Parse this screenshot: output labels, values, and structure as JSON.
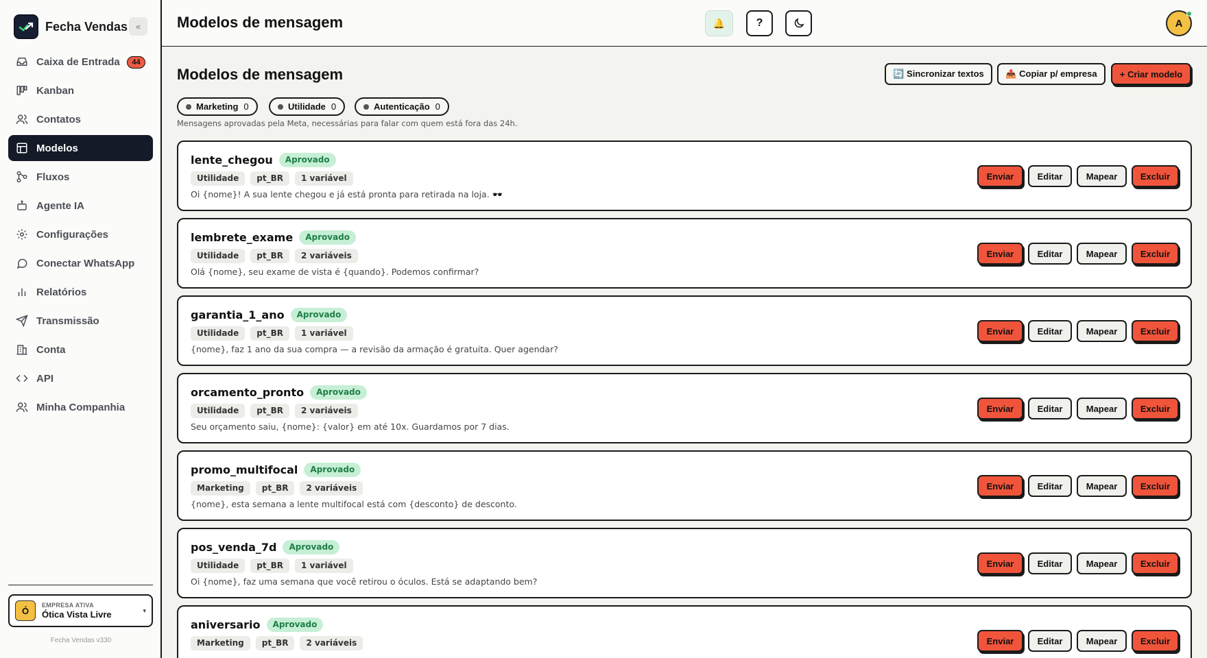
{
  "app": {
    "name": "Fecha Vendas",
    "collapse_icon": "«",
    "version": "Fecha Vendas v330"
  },
  "sidebar": {
    "items": [
      {
        "label": "Caixa de Entrada",
        "icon": "inbox-icon",
        "badge": "44"
      },
      {
        "label": "Kanban",
        "icon": "kanban-icon"
      },
      {
        "label": "Contatos",
        "icon": "contacts-icon"
      },
      {
        "label": "Modelos",
        "icon": "templates-icon",
        "active": true
      },
      {
        "label": "Fluxos",
        "icon": "flows-icon"
      },
      {
        "label": "Agente IA",
        "icon": "robot-icon"
      },
      {
        "label": "Configurações",
        "icon": "gear-icon"
      },
      {
        "label": "Conectar WhatsApp",
        "icon": "chat-bubble-icon"
      },
      {
        "label": "Relatórios",
        "icon": "bar-chart-icon"
      },
      {
        "label": "Transmissão",
        "icon": "send-icon"
      },
      {
        "label": "Conta",
        "icon": "building-icon"
      },
      {
        "label": "API",
        "icon": "code-icon"
      },
      {
        "label": "Minha Companhia",
        "icon": "users-icon"
      }
    ],
    "company": {
      "label": "EMPRESA ATIVA",
      "initial": "Ó",
      "name": "Ótica Vista Livre",
      "caret": "▾"
    }
  },
  "header": {
    "title": "Modelos de mensagem",
    "bell": "🔔",
    "help": "?",
    "user_initial": "A"
  },
  "main": {
    "title": "Modelos de mensagem",
    "actions": {
      "sync": "🔄 Sincronizar textos",
      "copy": "📤 Copiar p/ empresa",
      "create": "+ Criar modelo"
    },
    "filters": [
      {
        "label": "Marketing",
        "count": "0"
      },
      {
        "label": "Utilidade",
        "count": "0"
      },
      {
        "label": "Autenticação",
        "count": "0"
      }
    ],
    "subtitle": "Mensagens aprovadas pela Meta, necessárias para falar com quem está fora das 24h.",
    "button_labels": {
      "send": "Enviar",
      "edit": "Editar",
      "map": "Mapear",
      "delete": "Excluir"
    },
    "templates": [
      {
        "name": "lente_chegou",
        "status": "Aprovado",
        "category": "Utilidade",
        "language": "pt_BR",
        "variables": "1 variável",
        "body": "Oi {nome}! A sua lente chegou e já está pronta para retirada na loja. 🕶️"
      },
      {
        "name": "lembrete_exame",
        "status": "Aprovado",
        "category": "Utilidade",
        "language": "pt_BR",
        "variables": "2 variáveis",
        "body": "Olá {nome}, seu exame de vista é {quando}. Podemos confirmar?"
      },
      {
        "name": "garantia_1_ano",
        "status": "Aprovado",
        "category": "Utilidade",
        "language": "pt_BR",
        "variables": "1 variável",
        "body": "{nome}, faz 1 ano da sua compra — a revisão da armação é gratuita. Quer agendar?"
      },
      {
        "name": "orcamento_pronto",
        "status": "Aprovado",
        "category": "Utilidade",
        "language": "pt_BR",
        "variables": "2 variáveis",
        "body": "Seu orçamento saiu, {nome}: {valor} em até 10x. Guardamos por 7 dias."
      },
      {
        "name": "promo_multifocal",
        "status": "Aprovado",
        "category": "Marketing",
        "language": "pt_BR",
        "variables": "2 variáveis",
        "body": "{nome}, esta semana a lente multifocal está com {desconto} de desconto."
      },
      {
        "name": "pos_venda_7d",
        "status": "Aprovado",
        "category": "Utilidade",
        "language": "pt_BR",
        "variables": "1 variável",
        "body": "Oi {nome}, faz uma semana que você retirou o óculos. Está se adaptando bem?"
      },
      {
        "name": "aniversario",
        "status": "Aprovado",
        "category": "Marketing",
        "language": "pt_BR",
        "variables": "2 variáveis",
        "body": ""
      }
    ]
  }
}
